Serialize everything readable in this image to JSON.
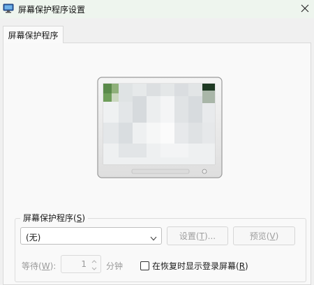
{
  "window": {
    "title": "屏幕保护程序设置",
    "app_icon": "screensaver-icon",
    "close_icon": "close-icon"
  },
  "tabs": [
    {
      "label": "屏幕保护程序",
      "selected": true
    }
  ],
  "preview": {
    "icon": "monitor-preview-icon"
  },
  "screensaver_group": {
    "legend": "屏幕保护程序(",
    "legend_key": "S",
    "legend_end": ")",
    "selected_value": "(无)",
    "settings_button": {
      "label": "设置(",
      "key": "T",
      "end": ")...",
      "enabled": false
    },
    "preview_button": {
      "label": "预览(",
      "key": "V",
      "end": ")",
      "enabled": false
    },
    "wait_label": "等待(",
    "wait_key": "W",
    "wait_end": "):",
    "wait_value": "1",
    "minutes_label": "分钟",
    "resume_checkbox": {
      "label": "在恢复时显示登录屏幕(",
      "key": "R",
      "end": ")",
      "checked": false
    }
  },
  "colors": {
    "titlebar_bg": "#eef5ee",
    "panel_bg": "#f9f9f9",
    "disabled_text": "#9e9e9e"
  }
}
